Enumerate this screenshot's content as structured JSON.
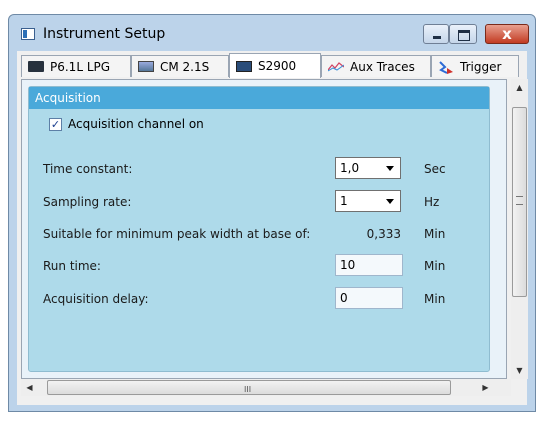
{
  "window": {
    "title": "Instrument Setup",
    "close_glyph": "x"
  },
  "tabs": [
    {
      "label": "P6.1L LPG",
      "icon": "device-icon"
    },
    {
      "label": "CM 2.1S",
      "icon": "module-icon"
    },
    {
      "label": "S2900",
      "icon": "detector-icon",
      "active": true
    },
    {
      "label": "Aux Traces",
      "icon": "traces-icon"
    },
    {
      "label": "Trigger",
      "icon": "trigger-icon"
    }
  ],
  "acquisition": {
    "header": "Acquisition",
    "channel_on_label": "Acquisition channel on",
    "channel_on_checked": true,
    "time_constant": {
      "label": "Time constant:",
      "value": "1,0",
      "unit": "Sec"
    },
    "sampling_rate": {
      "label": "Sampling rate:",
      "value": "1",
      "unit": "Hz"
    },
    "peak_width": {
      "label": "Suitable for minimum peak width at base of:",
      "value": "0,333",
      "unit": "Min"
    },
    "run_time": {
      "label": "Run time:",
      "value": "10",
      "unit": "Min"
    },
    "acq_delay": {
      "label": "Acquisition delay:",
      "value": "0",
      "unit": "Min"
    }
  },
  "scroll": {
    "grip_label": "III"
  }
}
